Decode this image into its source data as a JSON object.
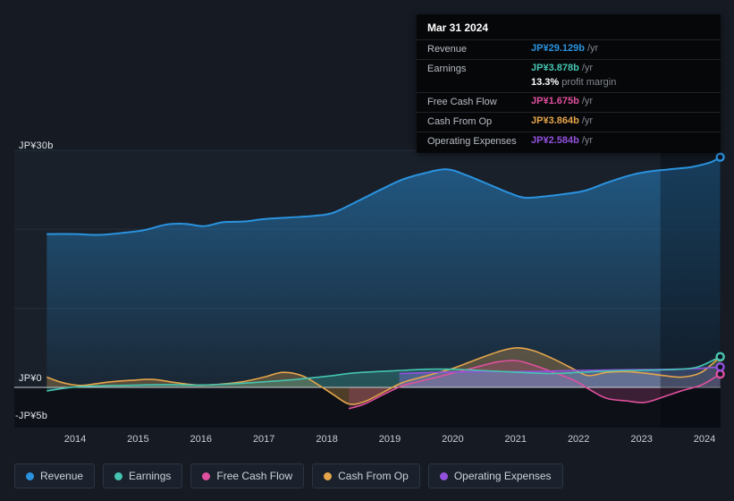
{
  "tooltip": {
    "date": "Mar 31 2024",
    "rows": [
      {
        "label": "Revenue",
        "value": "JP¥29.129b",
        "suffix": "/yr",
        "color": "#2a93df"
      },
      {
        "label": "Earnings",
        "value": "JP¥3.878b",
        "suffix": "/yr",
        "color": "#45c5b1",
        "sub_value": "13.3%",
        "sub_text": "profit margin"
      },
      {
        "label": "Free Cash Flow",
        "value": "JP¥1.675b",
        "suffix": "/yr",
        "color": "#e0509e"
      },
      {
        "label": "Cash From Op",
        "value": "JP¥3.864b",
        "suffix": "/yr",
        "color": "#e5a54b"
      },
      {
        "label": "Operating Expenses",
        "value": "JP¥2.584b",
        "suffix": "/yr",
        "color": "#9351dd"
      }
    ]
  },
  "axes": {
    "y_labels": [
      "JP¥30b",
      "JP¥0",
      "-JP¥5b"
    ]
  },
  "legend": [
    "Revenue",
    "Earnings",
    "Free Cash Flow",
    "Cash From Op",
    "Operating Expenses"
  ],
  "chart_data": {
    "type": "area",
    "title": "",
    "xlabel": "",
    "ylabel": "JP¥ billions",
    "x_unit": "year",
    "ylim_b": [
      -5,
      30
    ],
    "grid": true,
    "legend_position": "bottom",
    "x_ticks": [
      "2014",
      "2015",
      "2016",
      "2017",
      "2018",
      "2019",
      "2020",
      "2021",
      "2022",
      "2023",
      "2024"
    ],
    "y_gridlines_b": [
      30,
      20,
      10,
      0
    ],
    "highlight_period_years": [
      2023.3,
      2024.33
    ],
    "series": [
      {
        "name": "Revenue",
        "color": "#2a93df",
        "points": [
          [
            2013.55,
            19.4
          ],
          [
            2014.0,
            19.4
          ],
          [
            2014.4,
            19.3
          ],
          [
            2014.8,
            19.6
          ],
          [
            2015.1,
            19.9
          ],
          [
            2015.45,
            20.6
          ],
          [
            2015.75,
            20.7
          ],
          [
            2016.05,
            20.4
          ],
          [
            2016.35,
            20.9
          ],
          [
            2016.7,
            21.0
          ],
          [
            2017.0,
            21.3
          ],
          [
            2017.4,
            21.5
          ],
          [
            2017.8,
            21.7
          ],
          [
            2018.1,
            22.1
          ],
          [
            2018.5,
            23.6
          ],
          [
            2018.85,
            25.0
          ],
          [
            2019.2,
            26.3
          ],
          [
            2019.55,
            27.1
          ],
          [
            2019.9,
            27.6
          ],
          [
            2020.2,
            26.9
          ],
          [
            2020.6,
            25.6
          ],
          [
            2020.9,
            24.6
          ],
          [
            2021.15,
            24.0
          ],
          [
            2021.5,
            24.2
          ],
          [
            2021.8,
            24.5
          ],
          [
            2022.1,
            24.9
          ],
          [
            2022.45,
            25.9
          ],
          [
            2022.8,
            26.8
          ],
          [
            2023.1,
            27.3
          ],
          [
            2023.45,
            27.6
          ],
          [
            2023.8,
            27.9
          ],
          [
            2024.1,
            28.5
          ],
          [
            2024.25,
            29.129
          ]
        ]
      },
      {
        "name": "Earnings",
        "color": "#45c5b1",
        "points": [
          [
            2013.55,
            -0.45
          ],
          [
            2014.0,
            0.05
          ],
          [
            2014.5,
            0.2
          ],
          [
            2015.0,
            0.3
          ],
          [
            2015.5,
            0.35
          ],
          [
            2016.0,
            0.3
          ],
          [
            2016.5,
            0.45
          ],
          [
            2017.0,
            0.7
          ],
          [
            2017.5,
            1.0
          ],
          [
            2018.0,
            1.4
          ],
          [
            2018.4,
            1.8
          ],
          [
            2018.8,
            2.0
          ],
          [
            2019.2,
            2.15
          ],
          [
            2019.6,
            2.3
          ],
          [
            2020.0,
            2.3
          ],
          [
            2020.4,
            2.15
          ],
          [
            2020.8,
            2.0
          ],
          [
            2021.2,
            1.85
          ],
          [
            2021.6,
            1.75
          ],
          [
            2022.0,
            1.9
          ],
          [
            2022.4,
            2.05
          ],
          [
            2022.8,
            2.15
          ],
          [
            2023.2,
            2.2
          ],
          [
            2023.6,
            2.3
          ],
          [
            2023.9,
            2.6
          ],
          [
            2024.25,
            3.878
          ]
        ]
      },
      {
        "name": "Free Cash Flow",
        "color": "#e0509e",
        "points": [
          [
            2018.35,
            -2.7
          ],
          [
            2018.6,
            -2.1
          ],
          [
            2018.9,
            -0.9
          ],
          [
            2019.2,
            0.2
          ],
          [
            2019.5,
            0.8
          ],
          [
            2019.9,
            1.6
          ],
          [
            2020.3,
            2.4
          ],
          [
            2020.7,
            3.2
          ],
          [
            2021.0,
            3.4
          ],
          [
            2021.25,
            2.9
          ],
          [
            2021.6,
            1.9
          ],
          [
            2021.95,
            0.8
          ],
          [
            2022.2,
            -0.4
          ],
          [
            2022.45,
            -1.4
          ],
          [
            2022.75,
            -1.7
          ],
          [
            2023.05,
            -1.9
          ],
          [
            2023.35,
            -1.2
          ],
          [
            2023.65,
            -0.4
          ],
          [
            2023.95,
            0.3
          ],
          [
            2024.25,
            1.675
          ]
        ]
      },
      {
        "name": "Cash From Op",
        "color": "#e5a54b",
        "points": [
          [
            2013.55,
            1.3
          ],
          [
            2013.8,
            0.6
          ],
          [
            2014.1,
            0.25
          ],
          [
            2014.5,
            0.65
          ],
          [
            2014.9,
            0.9
          ],
          [
            2015.25,
            1.0
          ],
          [
            2015.6,
            0.6
          ],
          [
            2015.95,
            0.3
          ],
          [
            2016.3,
            0.4
          ],
          [
            2016.65,
            0.7
          ],
          [
            2017.0,
            1.3
          ],
          [
            2017.3,
            1.9
          ],
          [
            2017.6,
            1.5
          ],
          [
            2017.85,
            0.4
          ],
          [
            2018.1,
            -0.9
          ],
          [
            2018.35,
            -2.1
          ],
          [
            2018.6,
            -1.8
          ],
          [
            2018.9,
            -0.6
          ],
          [
            2019.2,
            0.6
          ],
          [
            2019.6,
            1.5
          ],
          [
            2020.0,
            2.4
          ],
          [
            2020.4,
            3.6
          ],
          [
            2020.8,
            4.7
          ],
          [
            2021.05,
            5.0
          ],
          [
            2021.3,
            4.6
          ],
          [
            2021.6,
            3.6
          ],
          [
            2021.9,
            2.4
          ],
          [
            2022.15,
            1.5
          ],
          [
            2022.45,
            1.9
          ],
          [
            2022.75,
            2.0
          ],
          [
            2023.05,
            1.8
          ],
          [
            2023.35,
            1.5
          ],
          [
            2023.65,
            1.3
          ],
          [
            2023.95,
            1.9
          ],
          [
            2024.25,
            3.864
          ]
        ]
      },
      {
        "name": "Operating Expenses",
        "color": "#9351dd",
        "points": [
          [
            2019.15,
            1.75
          ],
          [
            2019.5,
            1.85
          ],
          [
            2020.0,
            1.95
          ],
          [
            2020.5,
            2.0
          ],
          [
            2021.0,
            2.0
          ],
          [
            2021.5,
            2.05
          ],
          [
            2022.0,
            2.15
          ],
          [
            2022.5,
            2.2
          ],
          [
            2023.0,
            2.25
          ],
          [
            2023.5,
            2.3
          ],
          [
            2023.9,
            2.4
          ],
          [
            2024.25,
            2.584
          ]
        ]
      }
    ]
  }
}
